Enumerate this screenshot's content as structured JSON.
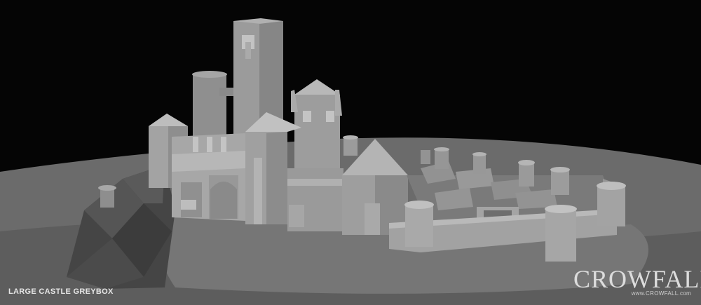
{
  "caption": "LARGE CASTLE GREYBOX",
  "logo": {
    "wordmark": "CROWFALL",
    "url": "www.CROWFALL.com"
  },
  "colors": {
    "background": "#050505",
    "ground": "#6a6a6a",
    "castle": "#9a9a9a",
    "shadow": "#5a5a5a"
  }
}
